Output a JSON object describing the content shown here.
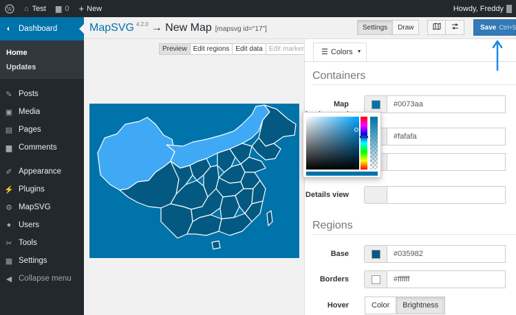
{
  "adminbar": {
    "site_name": "Test",
    "comments_count": "0",
    "new_label": "New",
    "greeting": "Howdy, Freddy"
  },
  "sidebar": {
    "dashboard": "Dashboard",
    "sub": [
      "Home",
      "Updates"
    ],
    "items": [
      "Posts",
      "Media",
      "Pages",
      "Comments",
      "Appearance",
      "Plugins",
      "MapSVG",
      "Users",
      "Tools",
      "Settings"
    ],
    "collapse": "Collapse menu"
  },
  "header": {
    "app": "MapSVG",
    "version": "4.2.0",
    "title_rest": "→ New Map",
    "shortcode": "[mapsvg id=\"17\"]"
  },
  "toolbar": {
    "settings": "Settings",
    "draw": "Draw",
    "save": "Save",
    "save_hint": "Ctrl+S"
  },
  "tabs": [
    "Preview",
    "Edit regions",
    "Edit data",
    "Edit markers"
  ],
  "panel": {
    "tab_label": "Colors",
    "containers_heading": "Containers",
    "regions_heading": "Regions",
    "map_background_label": "Map background",
    "map_background_value": "#0073aa",
    "second_value": "#fafafa",
    "details_label": "Details view",
    "base_label": "Base",
    "base_value": "#035982",
    "borders_label": "Borders",
    "borders_value": "#ffffff",
    "hover_label": "Hover",
    "hover_options": [
      "Color",
      "Brightness"
    ]
  },
  "colors": {
    "accent": "#0073aa",
    "map_bg": "#0073aa",
    "region_base": "#035982",
    "region_highlight": "#3fa9f5",
    "region_border": "#ffffff",
    "save_button": "#337ab7"
  }
}
